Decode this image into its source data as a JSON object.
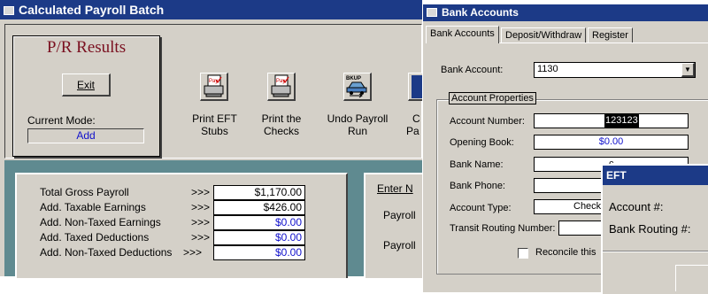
{
  "payroll_window": {
    "title": "Calculated Payroll Batch",
    "results_box": {
      "heading": "P/R Results",
      "exit_label": "Exit",
      "mode_label": "Current Mode:",
      "mode_value": "Add"
    },
    "toolbar": [
      {
        "label": "Print EFT Stubs",
        "icon": "paystub-printer-icon"
      },
      {
        "label": "Print the Checks",
        "icon": "check-printer-icon"
      },
      {
        "label": "Undo Payroll Run",
        "icon": "backup-car-icon"
      },
      {
        "label": "C",
        "label2": "Pa",
        "icon": "partial-icon"
      }
    ],
    "undo_icon_text": "BKUP",
    "totals": [
      {
        "label": "Total Gross Payroll",
        "arrows": ">>>",
        "value": "$1,170.00",
        "blue": false
      },
      {
        "label": "Add. Taxable Earnings",
        "arrows": ">>>",
        "value": "$426.00",
        "blue": false
      },
      {
        "label": "Add. Non-Taxed Earnings",
        "arrows": ">>>",
        "value": "$0.00",
        "blue": true
      },
      {
        "label": "Add. Taxed Deductions",
        "arrows": ">>>",
        "value": "$0.00",
        "blue": true
      },
      {
        "label": "Add. Non-Taxed Deductions",
        "arrows": ">>>",
        "value": "$0.00",
        "blue": true
      }
    ],
    "right_panel": {
      "enter_label": "Enter N",
      "payroll1": "Payroll",
      "payroll2": "Payroll"
    }
  },
  "bank_window": {
    "title": "Bank Accounts",
    "tabs": [
      "Bank Accounts",
      "Deposit/Withdraw",
      "Register"
    ],
    "bank_account_label": "Bank Account:",
    "bank_account_value": "1130",
    "group_label": "Account Properties",
    "fields": [
      {
        "label": "Account Number:",
        "value": "123123"
      },
      {
        "label": "Opening Book:",
        "value": "$0.00"
      },
      {
        "label": "Bank Name:",
        "value": "c"
      },
      {
        "label": "Bank Phone:",
        "value": ""
      },
      {
        "label": "Account Type:",
        "value": "Check"
      }
    ],
    "transit_label": "Transit Routing Number:",
    "reconcile_label": "Reconcile this"
  },
  "eft_window": {
    "title": "EFT",
    "account_label": "Account #:",
    "routing_label": "Bank Routing #:"
  }
}
